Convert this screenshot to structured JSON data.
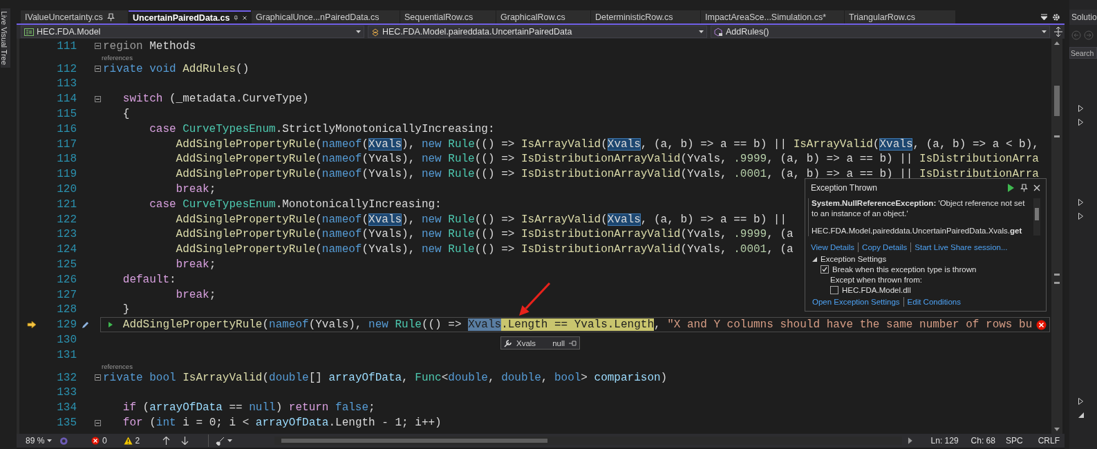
{
  "side_strip": {
    "label": "Live Visual Tree"
  },
  "tabs": [
    {
      "label": "IValueUncertainty.cs",
      "selected": false,
      "pinned": true
    },
    {
      "label": "UncertainPairedData.cs",
      "selected": true,
      "pinned": false
    },
    {
      "label": "GraphicalUnce...nPairedData.cs",
      "selected": false,
      "pinned": false
    },
    {
      "label": "SequentialRow.cs",
      "selected": false,
      "pinned": false
    },
    {
      "label": "GraphicalRow.cs",
      "selected": false,
      "pinned": false
    },
    {
      "label": "DeterministicRow.cs",
      "selected": false,
      "pinned": false
    },
    {
      "label": "ImpactAreaSce...Simulation.cs*",
      "selected": false,
      "pinned": false
    },
    {
      "label": "TriangularRow.cs",
      "selected": false,
      "pinned": false
    }
  ],
  "nav_bar": {
    "project": "HEC.FDA.Model",
    "type": "HEC.FDA.Model.paireddata.UncertainPairedData",
    "member": "AddRules()"
  },
  "editor": {
    "lines": [
      {
        "number": "111",
        "fold": true,
        "current": false,
        "tokens": [
          {
            "text": "region",
            "kind": "preprocessor"
          },
          {
            "text": " Methods"
          }
        ]
      },
      {
        "number": "112",
        "fold": true,
        "current": false,
        "codelens": "references",
        "tokens": [
          {
            "text": "rivate void",
            "kind": "keyword"
          },
          {
            "text": " AddRules",
            "kind": "method"
          },
          {
            "text": "()"
          }
        ]
      },
      {
        "number": "113",
        "fold": false,
        "current": false
      },
      {
        "number": "114",
        "fold": true,
        "current": false,
        "tokens": [
          {
            "text": "   switch",
            "kind": "control"
          },
          {
            "text": " (_metadata.CurveType)"
          }
        ]
      },
      {
        "number": "115",
        "fold": false,
        "current": false,
        "tokens": [
          {
            "text": "   {"
          }
        ]
      },
      {
        "number": "116",
        "fold": false,
        "current": false,
        "tokens": [
          {
            "text": "       case",
            "kind": "control"
          },
          {
            "text": " CurveTypesEnum",
            "kind": "type"
          },
          {
            "text": ".StrictlyMonotonicallyIncreasing:"
          }
        ]
      },
      {
        "number": "117",
        "fold": false,
        "current": false,
        "tokens": [
          {
            "text": "           AddSinglePropertyRule",
            "kind": "method"
          },
          {
            "text": "("
          },
          {
            "text": "nameof",
            "kind": "keyword"
          },
          {
            "text": "("
          },
          {
            "text": "Xvals",
            "kind": "reference"
          },
          {
            "text": "), "
          },
          {
            "text": "new",
            "kind": "keyword"
          },
          {
            "text": " Rule",
            "kind": "type"
          },
          {
            "text": "(() => "
          },
          {
            "text": "IsArrayValid",
            "kind": "method"
          },
          {
            "text": "("
          },
          {
            "text": "Xvals",
            "kind": "reference"
          },
          {
            "text": ", (a, b) => a == b) || "
          },
          {
            "text": "IsArrayValid",
            "kind": "method"
          },
          {
            "text": "("
          },
          {
            "text": "Xvals",
            "kind": "reference"
          },
          {
            "text": ", (a, b) => a < b),"
          }
        ]
      },
      {
        "number": "118",
        "fold": false,
        "current": false,
        "tokens": [
          {
            "text": "           AddSinglePropertyRule",
            "kind": "method"
          },
          {
            "text": "("
          },
          {
            "text": "nameof",
            "kind": "keyword"
          },
          {
            "text": "(Yvals), "
          },
          {
            "text": "new",
            "kind": "keyword"
          },
          {
            "text": " Rule",
            "kind": "type"
          },
          {
            "text": "(() => "
          },
          {
            "text": "IsDistributionArrayValid",
            "kind": "method"
          },
          {
            "text": "(Yvals, "
          },
          {
            "text": ".9999",
            "kind": "number"
          },
          {
            "text": ", (a, b) => a == b) || "
          },
          {
            "text": "IsDistributionArra",
            "kind": "method"
          }
        ]
      },
      {
        "number": "119",
        "fold": false,
        "current": false,
        "tokens": [
          {
            "text": "           AddSinglePropertyRule",
            "kind": "method"
          },
          {
            "text": "("
          },
          {
            "text": "nameof",
            "kind": "keyword"
          },
          {
            "text": "(Yvals), "
          },
          {
            "text": "new",
            "kind": "keyword"
          },
          {
            "text": " Rule",
            "kind": "type"
          },
          {
            "text": "(() => "
          },
          {
            "text": "IsDistributionArrayValid",
            "kind": "method"
          },
          {
            "text": "(Yvals, "
          },
          {
            "text": ".0001",
            "kind": "number"
          },
          {
            "text": ", (a, b) => a == b) || "
          },
          {
            "text": "IsDistributionArra",
            "kind": "method"
          }
        ]
      },
      {
        "number": "120",
        "fold": false,
        "current": false,
        "tokens": [
          {
            "text": "           break",
            "kind": "control"
          },
          {
            "text": ";"
          }
        ]
      },
      {
        "number": "121",
        "fold": false,
        "current": false,
        "tokens": [
          {
            "text": "       case",
            "kind": "control"
          },
          {
            "text": " CurveTypesEnum",
            "kind": "type"
          },
          {
            "text": ".MonotonicallyIncreasing:"
          }
        ]
      },
      {
        "number": "122",
        "fold": false,
        "current": false,
        "tokens": [
          {
            "text": "           AddSinglePropertyRule",
            "kind": "method"
          },
          {
            "text": "("
          },
          {
            "text": "nameof",
            "kind": "keyword"
          },
          {
            "text": "("
          },
          {
            "text": "Xvals",
            "kind": "reference"
          },
          {
            "text": "), "
          },
          {
            "text": "new",
            "kind": "keyword"
          },
          {
            "text": " Rule",
            "kind": "type"
          },
          {
            "text": "(() => "
          },
          {
            "text": "IsArrayValid",
            "kind": "method"
          },
          {
            "text": "("
          },
          {
            "text": "Xvals",
            "kind": "reference"
          },
          {
            "text": ", (a, b) => a == b) ||"
          }
        ]
      },
      {
        "number": "123",
        "fold": false,
        "current": false,
        "tokens": [
          {
            "text": "           AddSinglePropertyRule",
            "kind": "method"
          },
          {
            "text": "("
          },
          {
            "text": "nameof",
            "kind": "keyword"
          },
          {
            "text": "(Yvals), "
          },
          {
            "text": "new",
            "kind": "keyword"
          },
          {
            "text": " Rule",
            "kind": "type"
          },
          {
            "text": "(() => "
          },
          {
            "text": "IsDistributionArrayValid",
            "kind": "method"
          },
          {
            "text": "(Yvals, "
          },
          {
            "text": ".9999",
            "kind": "number"
          },
          {
            "text": ", (a"
          }
        ]
      },
      {
        "number": "124",
        "fold": false,
        "current": false,
        "tokens": [
          {
            "text": "           AddSinglePropertyRule",
            "kind": "method"
          },
          {
            "text": "("
          },
          {
            "text": "nameof",
            "kind": "keyword"
          },
          {
            "text": "(Yvals), "
          },
          {
            "text": "new",
            "kind": "keyword"
          },
          {
            "text": " Rule",
            "kind": "type"
          },
          {
            "text": "(() => "
          },
          {
            "text": "IsDistributionArrayValid",
            "kind": "method"
          },
          {
            "text": "(Yvals, "
          },
          {
            "text": ".0001",
            "kind": "number"
          },
          {
            "text": ", (a"
          }
        ]
      },
      {
        "number": "125",
        "fold": false,
        "current": false,
        "tokens": [
          {
            "text": "           break",
            "kind": "control"
          },
          {
            "text": ";"
          }
        ]
      },
      {
        "number": "126",
        "fold": false,
        "current": false,
        "tokens": [
          {
            "text": "   default",
            "kind": "control"
          },
          {
            "text": ":"
          }
        ]
      },
      {
        "number": "127",
        "fold": false,
        "current": false,
        "tokens": [
          {
            "text": "           break",
            "kind": "control"
          },
          {
            "text": ";"
          }
        ]
      },
      {
        "number": "128",
        "fold": false,
        "current": false,
        "tokens": [
          {
            "text": "   }"
          }
        ]
      },
      {
        "number": "129",
        "fold": false,
        "current": true,
        "tokens": [
          {
            "text": "   AddSinglePropertyRule",
            "kind": "method"
          },
          {
            "text": "("
          },
          {
            "text": "nameof",
            "kind": "keyword"
          },
          {
            "text": "(Yvals), "
          },
          {
            "text": "new",
            "kind": "keyword"
          },
          {
            "text": " Rule",
            "kind": "type"
          },
          {
            "text": "(() => "
          },
          {
            "text": "Xvals",
            "kind": "selection"
          },
          {
            "text": ".Length == Yvals.Length",
            "kind": "statement"
          },
          {
            "text": ", "
          },
          {
            "text": "\"X and Y columns should have the same number of rows bu",
            "kind": "string"
          }
        ]
      },
      {
        "number": "130",
        "fold": false,
        "current": false
      },
      {
        "number": "131",
        "fold": false,
        "current": false
      },
      {
        "number": "132",
        "fold": true,
        "current": false,
        "codelens": "references",
        "tokens": [
          {
            "text": "rivate bool",
            "kind": "keyword"
          },
          {
            "text": " IsArrayValid",
            "kind": "method"
          },
          {
            "text": "("
          },
          {
            "text": "double",
            "kind": "keyword"
          },
          {
            "text": "[] "
          },
          {
            "text": "arrayOfData",
            "kind": "param"
          },
          {
            "text": ", "
          },
          {
            "text": "Func",
            "kind": "type"
          },
          {
            "text": "<"
          },
          {
            "text": "double",
            "kind": "keyword"
          },
          {
            "text": ", "
          },
          {
            "text": "double",
            "kind": "keyword"
          },
          {
            "text": ", "
          },
          {
            "text": "bool",
            "kind": "keyword"
          },
          {
            "text": "> "
          },
          {
            "text": "comparison",
            "kind": "param"
          },
          {
            "text": ")"
          }
        ]
      },
      {
        "number": "133",
        "fold": false,
        "current": false
      },
      {
        "number": "134",
        "fold": false,
        "current": false,
        "tokens": [
          {
            "text": "   if",
            "kind": "control"
          },
          {
            "text": " ("
          },
          {
            "text": "arrayOfData",
            "kind": "param"
          },
          {
            "text": " == "
          },
          {
            "text": "null",
            "kind": "keyword"
          },
          {
            "text": ") "
          },
          {
            "text": "return",
            "kind": "control"
          },
          {
            "text": " false",
            "kind": "keyword"
          },
          {
            "text": ";"
          }
        ]
      },
      {
        "number": "135",
        "fold": true,
        "current": false,
        "tokens": [
          {
            "text": "   for",
            "kind": "control"
          },
          {
            "text": " ("
          },
          {
            "text": "int",
            "kind": "keyword"
          },
          {
            "text": " i = 0; i < "
          },
          {
            "text": "arrayOfData",
            "kind": "param"
          },
          {
            "text": ".Length - 1; i++)"
          }
        ]
      }
    ]
  },
  "datatip": {
    "name": "Xvals",
    "value": "null"
  },
  "exception": {
    "title": "Exception Thrown",
    "message": "**System.NullReferenceException:** 'Object reference not set to an instance of an object.'",
    "source": "HEC.FDA.Model.paireddata.UncertainPairedData.Xvals.**get**",
    "links": [
      "View Details",
      "Copy Details",
      "Start Live Share session..."
    ],
    "settings": {
      "title": "Exception Settings",
      "expanded": true,
      "break_when_thrown": {
        "label": "Break when this exception type is thrown",
        "checked": true
      },
      "except_label": "Except when thrown from:",
      "modules": [
        {
          "label": "HEC.FDA.Model.dll",
          "checked": false
        }
      ]
    },
    "footer_links": [
      "Open Exception Settings",
      "Edit Conditions"
    ]
  },
  "status_bar": {
    "zoom": "89 %",
    "errors": "0",
    "warnings": "2",
    "line": "Ln: 129",
    "column": "Ch: 68",
    "whitespace": "SPC",
    "line_ending": "CRLF"
  },
  "solution_explorer": {
    "title": "Solutio",
    "search_placeholder": "Search",
    "nodes": [
      {
        "expanded": false
      },
      {
        "expanded": false
      },
      {
        "expanded": false
      },
      {
        "expanded": false
      },
      {
        "expanded": false
      },
      {
        "expanded": true
      }
    ]
  }
}
